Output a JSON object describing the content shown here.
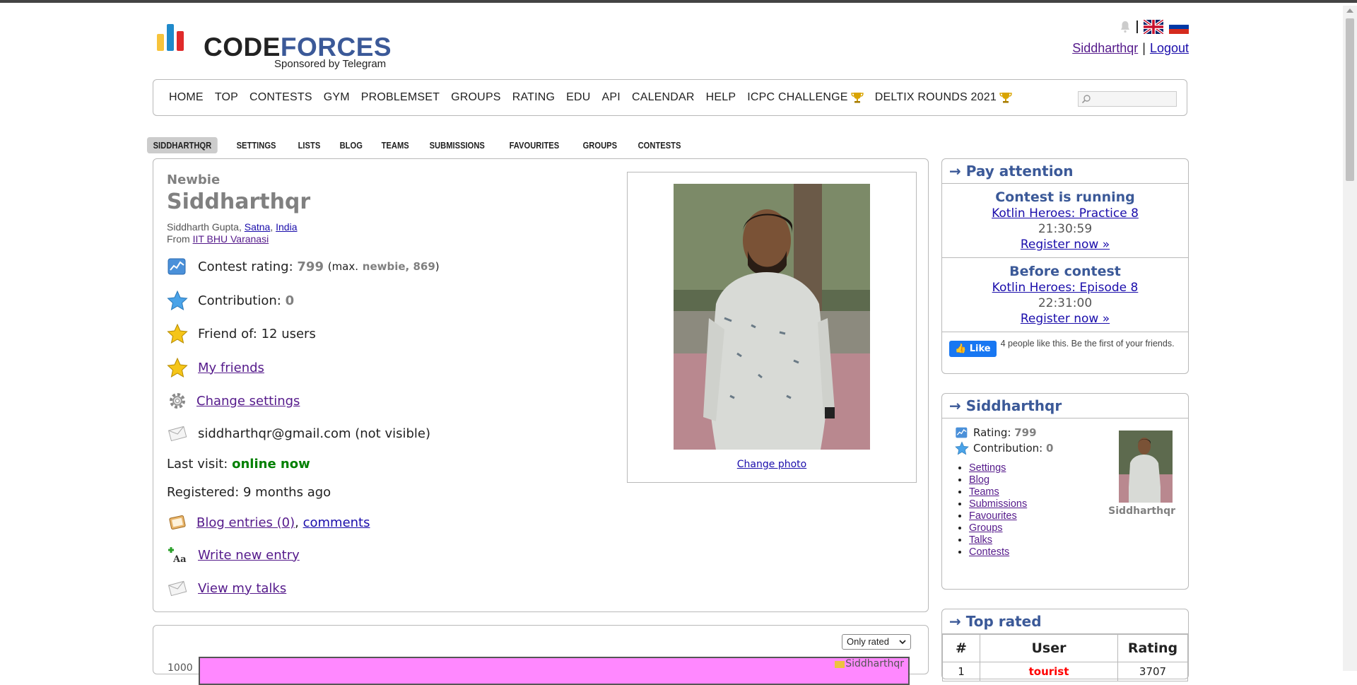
{
  "header": {
    "logo_code": "CODE",
    "logo_forces": "FORCES",
    "sponsor": "Sponsored by Telegram",
    "user_link": "Siddharthqr",
    "separator": "|",
    "logout": "Logout"
  },
  "main_nav": [
    "HOME",
    "TOP",
    "CONTESTS",
    "GYM",
    "PROBLEMSET",
    "GROUPS",
    "RATING",
    "EDU",
    "API",
    "CALENDAR",
    "HELP",
    "ICPC CHALLENGE",
    "DELTIX ROUNDS 2021"
  ],
  "sub_nav": [
    "SIDDHARTHQR",
    "SETTINGS",
    "LISTS",
    "BLOG",
    "TEAMS",
    "SUBMISSIONS",
    "FAVOURITES",
    "GROUPS",
    "CONTESTS"
  ],
  "profile": {
    "rank": "Newbie",
    "handle": "Siddharthqr",
    "name_prefix": "Siddharth Gupta,",
    "city": "Satna",
    "comma": ",",
    "country": "India",
    "from_label": "From",
    "organization": "IIT BHU Varanasi",
    "rating_label": "Contest rating:",
    "rating": "799",
    "max_open": "(max.",
    "max_rank": "newbie, 869",
    "max_close": ")",
    "contribution_label": "Contribution:",
    "contribution": "0",
    "friend_of": "Friend of: 12 users",
    "my_friends": "My friends",
    "change_settings": "Change settings",
    "email": "siddharthqr@gmail.com (not visible)",
    "last_visit_label": "Last visit:",
    "last_visit": "online now",
    "registered": "Registered: 9 months ago",
    "blog_entries": "Blog entries (0)",
    "blog_comma": ",",
    "comments": "comments",
    "write_entry": "Write new entry",
    "view_talks": "View my talks",
    "change_photo": "Change photo"
  },
  "chart": {
    "filter": "Only rated",
    "legend": "Siddharthqr",
    "y_tick": "1000"
  },
  "sidebar": {
    "pay_attention": "→ Pay attention",
    "contest_running_title": "Contest is running",
    "contest_running_name": "Kotlin Heroes: Practice 8",
    "contest_running_time": "21:30:59",
    "register1": "Register now »",
    "before_contest_title": "Before contest",
    "before_contest_name": "Kotlin Heroes: Episode 8",
    "before_contest_time": "22:31:00",
    "register2": "Register now »",
    "fb_like": "Like",
    "fb_text": "4 people like this. Be the first of your friends.",
    "user_box_title": "→ Siddharthqr",
    "rating_label": "Rating:",
    "rating": "799",
    "contribution_label": "Contribution:",
    "contribution": "0",
    "links": [
      "Settings",
      "Blog",
      "Teams",
      "Submissions",
      "Favourites",
      "Groups",
      "Talks",
      "Contests"
    ],
    "avatar_name": "Siddharthqr",
    "top_rated_title": "→ Top rated",
    "top_rated_headers": [
      "#",
      "User",
      "Rating"
    ],
    "top_rated_rows": [
      {
        "rank": "1",
        "user": "tourist",
        "rating": "3707"
      }
    ]
  },
  "colors": {
    "accent_blue": "#3b5998",
    "newbie_grey": "#808080",
    "online_green": "#008000",
    "legendary_red": "#ff0000"
  }
}
